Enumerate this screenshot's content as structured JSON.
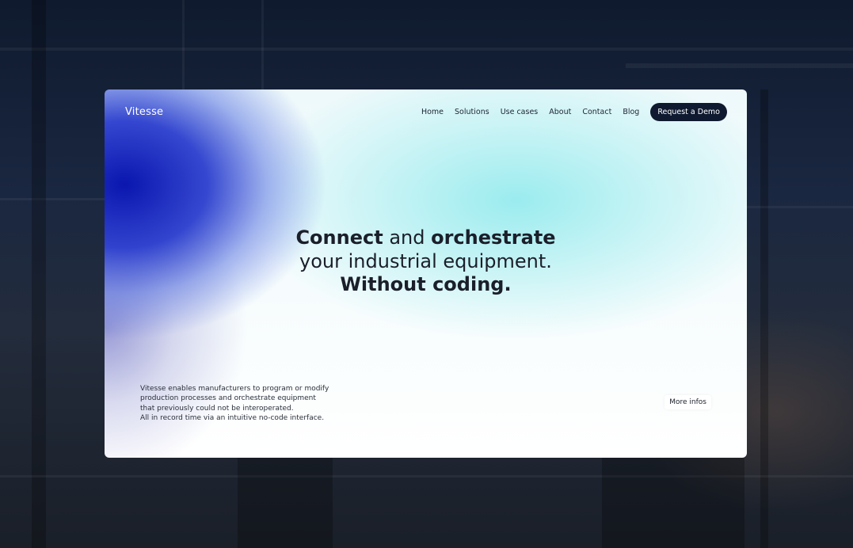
{
  "brand": {
    "name": "Vitesse"
  },
  "nav": {
    "links": [
      "Home",
      "Solutions",
      "Use cases",
      "About",
      "Contact",
      "Blog"
    ],
    "cta_label": "Request a Demo"
  },
  "hero": {
    "line1_bold_a": "Connect",
    "line1_regular": " and ",
    "line1_bold_b": "orchestrate",
    "line2": "your industrial equipment.",
    "line3": "Without coding."
  },
  "description": {
    "lines": [
      "Vitesse enables manufacturers to program or modify",
      "production processes and orchestrate equipment",
      "that previously could not be interoperated.",
      "All in record time via an intuitive no-code interface."
    ]
  },
  "more_button_label": "More infos",
  "colors": {
    "cta_background": "#0f1a30",
    "gradient_blue": "#0a16af",
    "gradient_cyan": "#96ebee",
    "page_background": "#16203a"
  }
}
